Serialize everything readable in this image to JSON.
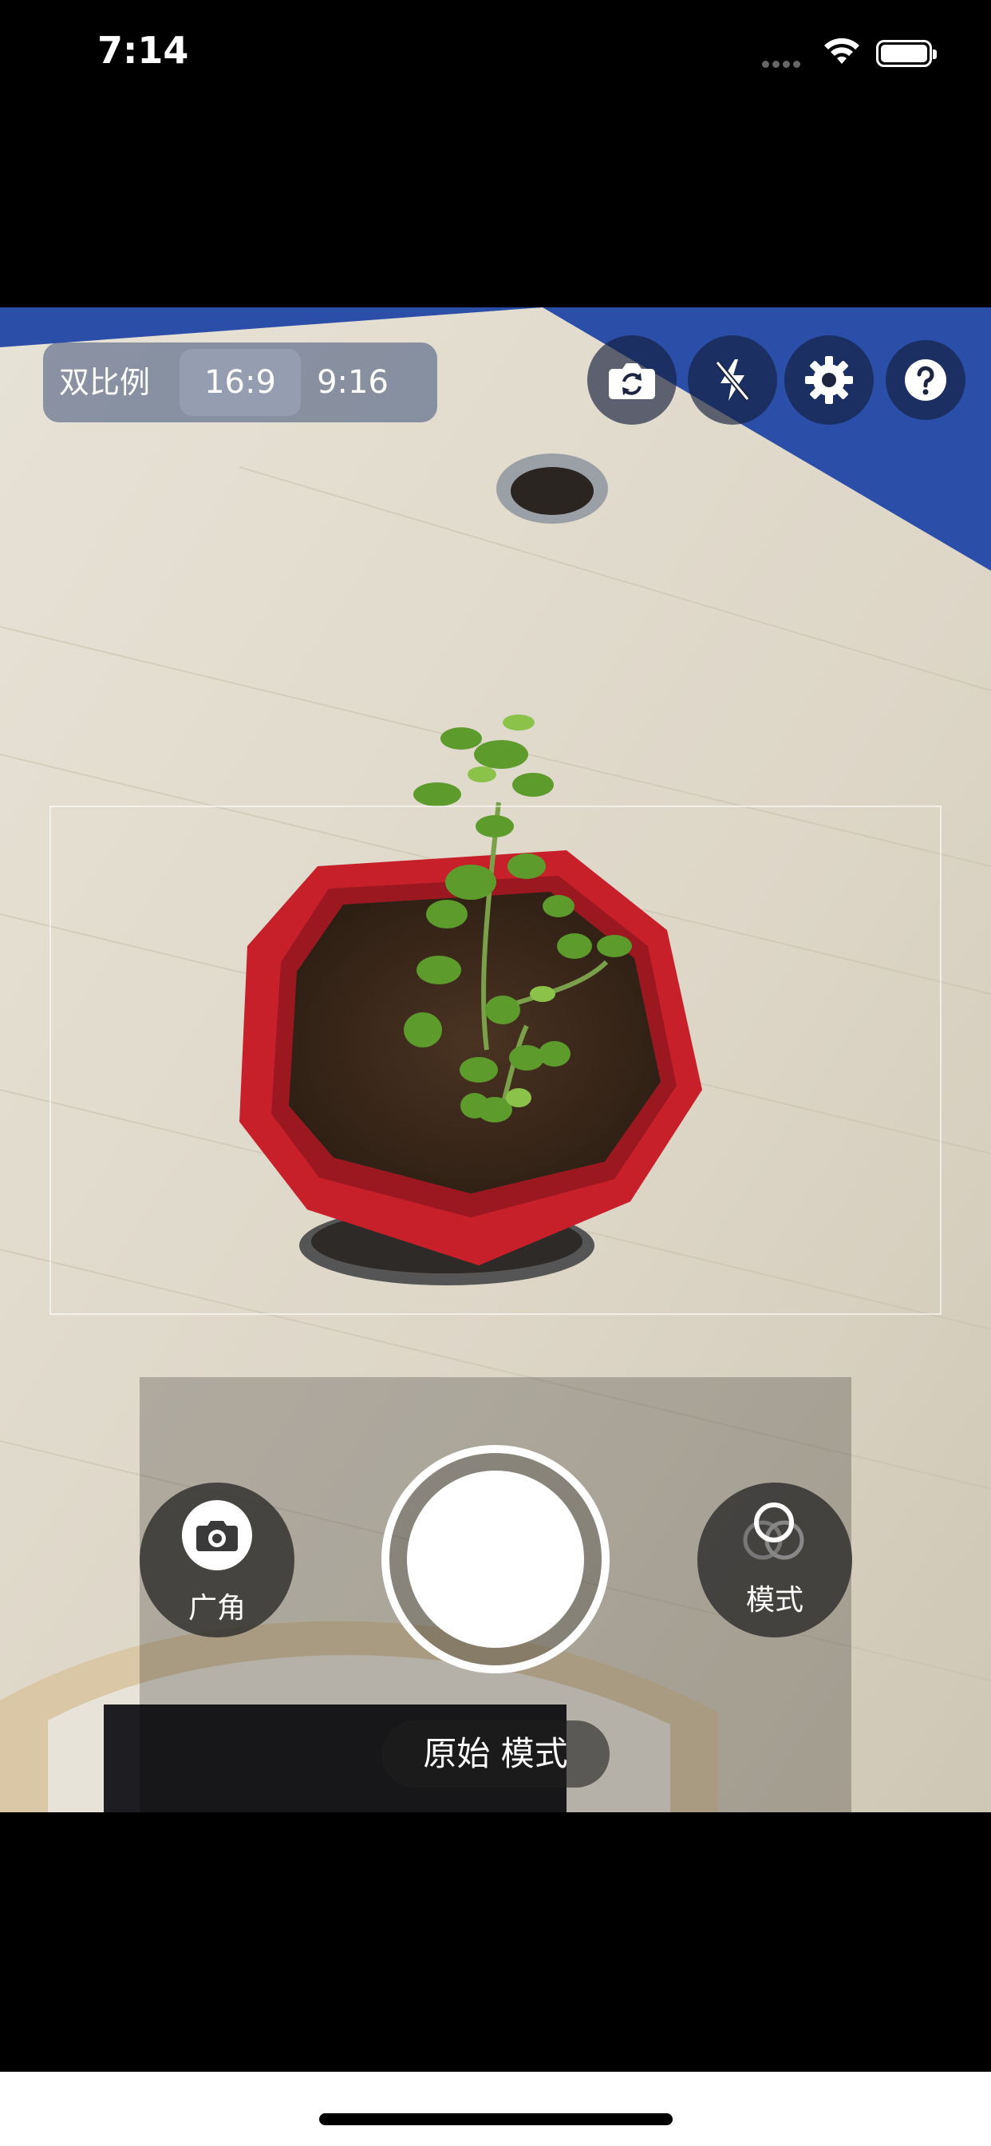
{
  "status_bar": {
    "time": "7:14"
  },
  "ratio_selector": {
    "label": "双比例",
    "options": [
      "16:9",
      "9:16"
    ],
    "selected": "16:9"
  },
  "toolbar": {
    "icons": [
      "switch-camera-icon",
      "flash-off-icon",
      "settings-icon",
      "help-icon"
    ]
  },
  "bottom_controls": {
    "wide_angle_label": "广角",
    "mode_label": "模式",
    "current_mode": "原始 模式"
  },
  "colors": {
    "desk_blue": "#2f56b4",
    "pot_red": "#c8202a",
    "accent_white": "#ffffff"
  }
}
